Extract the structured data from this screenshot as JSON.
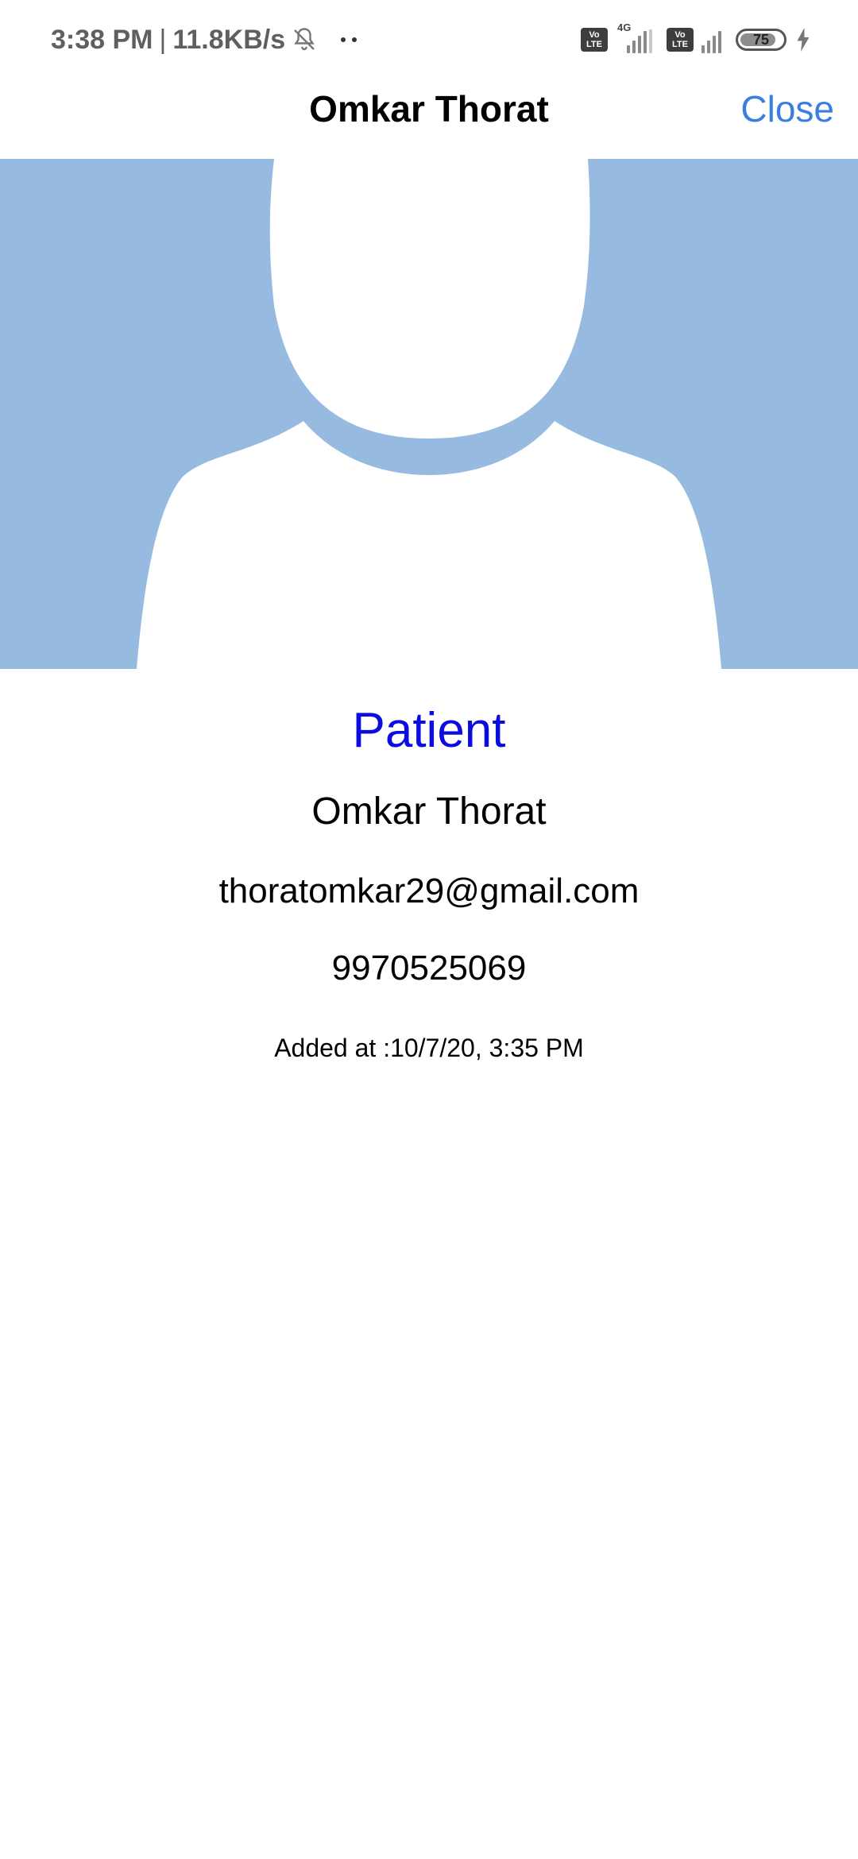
{
  "status_bar": {
    "time": "3:38 PM",
    "separator": "|",
    "speed": "11.8KB/s",
    "network_type": "4G",
    "volte_labels": [
      "Vo",
      "LTE"
    ],
    "battery_level": "75",
    "icons": [
      "bell-muted-icon",
      "more-dots-icon",
      "volte-icon",
      "signal-icon",
      "battery-icon",
      "charging-bolt-icon"
    ]
  },
  "header": {
    "title": "Omkar Thorat",
    "close_label": "Close"
  },
  "avatar": {
    "icon": "default-avatar-icon",
    "background_color": "#96bae0",
    "figure_color": "#ffffff"
  },
  "profile": {
    "role": "Patient",
    "name": "Omkar Thorat",
    "email": "thoratomkar29@gmail.com",
    "phone": "9970525069",
    "added_label": "Added at :",
    "added_value": "10/7/20, 3:35 PM"
  },
  "colors": {
    "accent": "#3a7ee0",
    "role": "#0c0ce0"
  }
}
